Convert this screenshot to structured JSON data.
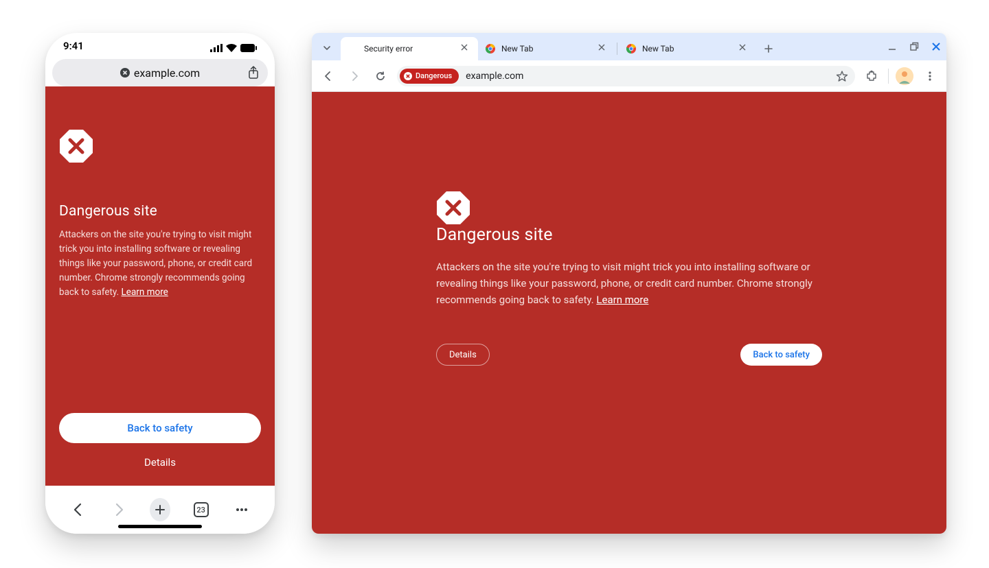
{
  "mobile": {
    "status_time": "9:41",
    "address_url": "example.com",
    "warning_title": "Dangerous site",
    "warning_body": "Attackers on the site you're trying to visit might trick you into installing software or revealing things like your password, phone, or credit card number. Chrome strongly recommends going back to safety. ",
    "learn_more": "Learn more",
    "back_to_safety": "Back to safety",
    "details": "Details",
    "tab_count": "23"
  },
  "desktop": {
    "tabs": [
      {
        "title": "Security error"
      },
      {
        "title": "New Tab"
      },
      {
        "title": "New Tab"
      }
    ],
    "danger_chip": "Dangerous",
    "omnibox_url": "example.com",
    "warning_title": "Dangerous site",
    "warning_body": "Attackers on the site you're trying to visit might trick you into installing software or revealing things like your password, phone, or credit card number. Chrome strongly recommends going back to safety. ",
    "learn_more": "Learn more",
    "details": "Details",
    "back_to_safety": "Back to safety"
  },
  "colors": {
    "danger": "#b52d27",
    "blue": "#1a73e8"
  }
}
